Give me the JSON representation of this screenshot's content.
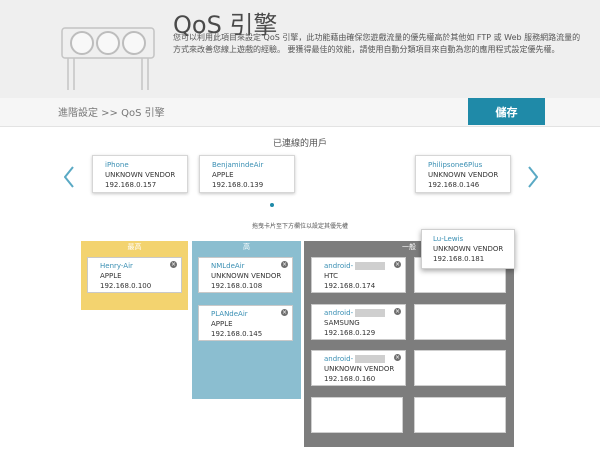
{
  "header": {
    "title": "QoS 引擎",
    "description": "您可以利用此項目來設定 QoS 引擎，此功能藉由確保您遊戲流量的優先權高於其他如 FTP 或 Web 服務網路流量的方式來改善您線上遊戲的經驗。 要獲得最佳的效能，請使用自動分類項目來自動為您的應用程式設定優先權。"
  },
  "nav": {
    "breadcrumb": "進階設定 >> QoS 引擎",
    "save_label": "儲存"
  },
  "connected": {
    "title": "已連線的用戶",
    "devices": [
      {
        "name": "iPhone",
        "vendor": "UNKNOWN VENDOR",
        "ip": "192.168.0.157"
      },
      {
        "name": "BenjamindeAir",
        "vendor": "APPLE",
        "ip": "192.168.0.139"
      },
      {
        "name": "Philipsone6Plus",
        "vendor": "UNKNOWN VENDOR",
        "ip": "192.168.0.146"
      }
    ],
    "hint": "拖曳卡片至下方欄位以設定其優先權"
  },
  "priorities": {
    "high": {
      "label": "最高",
      "cards": [
        {
          "name": "Henry-Air",
          "vendor": "APPLE",
          "ip": "192.168.0.100"
        }
      ]
    },
    "medium": {
      "label": "高",
      "cards": [
        {
          "name": "NMLdeAir",
          "vendor": "UNKNOWN VENDOR",
          "ip": "192.168.0.108"
        },
        {
          "name": "PLANdeAir",
          "vendor": "APPLE",
          "ip": "192.168.0.145"
        }
      ]
    },
    "normal": {
      "label": "一般",
      "cards": [
        {
          "name": "android-",
          "vendor": "HTC",
          "ip": "192.168.0.174"
        },
        {
          "name": "android-",
          "vendor": "SAMSUNG",
          "ip": "192.168.0.129"
        },
        {
          "name": "android-",
          "vendor": "UNKNOWN VENDOR",
          "ip": "192.168.0.160"
        }
      ]
    }
  },
  "dragging": {
    "name": "Lu-Lewis",
    "vendor": "UNKNOWN VENDOR",
    "ip": "192.168.0.181"
  },
  "colors": {
    "accent": "#1f8aa8",
    "high": "#f3d36f",
    "medium": "#8bbed0",
    "normal": "#7d7d7d"
  }
}
